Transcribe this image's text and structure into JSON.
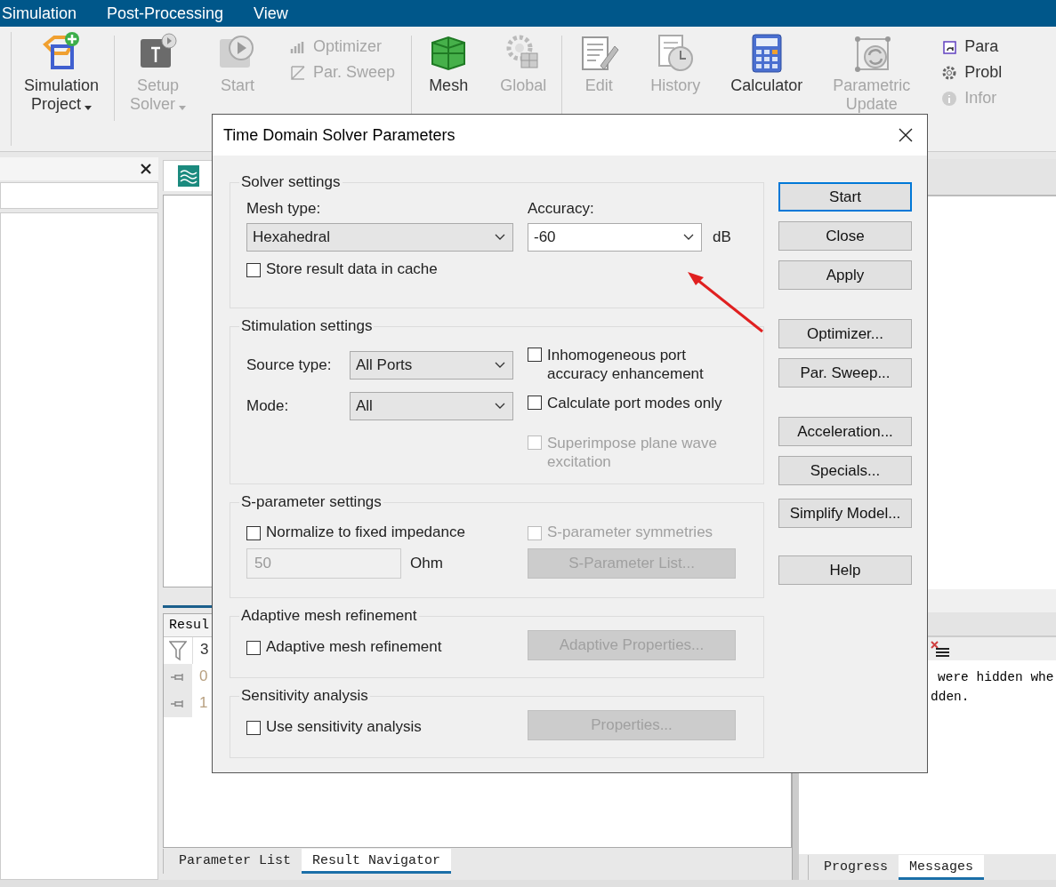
{
  "menu_bar": [
    "Simulation",
    "Post-Processing",
    "View"
  ],
  "ribbon": {
    "columns": [
      {
        "kind": "large",
        "lines": [
          "Simulation",
          "Project"
        ],
        "disabled": false,
        "dropdown": true
      },
      {
        "kind": "separator"
      },
      {
        "kind": "large",
        "lines": [
          "Setup",
          "Solver"
        ],
        "disabled": true,
        "dropdown": true
      },
      {
        "kind": "large",
        "lines": [
          "Start"
        ],
        "disabled": true,
        "dropdown": false
      },
      {
        "kind": "stack",
        "items": [
          {
            "label": "Optimizer",
            "disabled": true
          },
          {
            "label": "Par. Sweep",
            "disabled": true
          }
        ]
      },
      {
        "kind": "separator"
      },
      {
        "kind": "large",
        "lines": [
          "Mesh"
        ],
        "disabled": false,
        "dropdown": false
      },
      {
        "kind": "large",
        "lines": [
          "Global"
        ],
        "disabled": true,
        "dropdown": false
      },
      {
        "kind": "separator"
      },
      {
        "kind": "large",
        "lines": [
          "Edit"
        ],
        "disabled": true,
        "dropdown": false
      },
      {
        "kind": "large",
        "lines": [
          "History"
        ],
        "disabled": true,
        "dropdown": false
      },
      {
        "kind": "large",
        "lines": [
          "Calculator"
        ],
        "disabled": false,
        "dropdown": false
      },
      {
        "kind": "large",
        "lines": [
          "Parametric",
          "Update"
        ],
        "disabled": true,
        "dropdown": false
      },
      {
        "kind": "stack",
        "items": [
          {
            "label": "Para",
            "disabled": false
          },
          {
            "label": "Probl",
            "disabled": false
          },
          {
            "label": "Infor",
            "disabled": true
          }
        ]
      }
    ]
  },
  "result_panel": {
    "title": "Resul",
    "rows": [
      {
        "label": "3",
        "kind": "header"
      },
      {
        "label": "0",
        "kind": "row"
      },
      {
        "label": "1",
        "kind": "row"
      }
    ]
  },
  "bottom_tabs_left": [
    {
      "label": "Parameter List",
      "selected": false
    },
    {
      "label": "Result Navigator",
      "selected": true
    }
  ],
  "messages": [
    "were hidden whe",
    "dden."
  ],
  "bottom_tabs_right": [
    {
      "label": "Progress",
      "selected": false
    },
    {
      "label": "Messages",
      "selected": true
    }
  ],
  "dialog": {
    "title": "Time Domain Solver Parameters",
    "solver_settings": {
      "title": "Solver settings",
      "mesh_type": {
        "label": "Mesh type:",
        "value": "Hexahedral"
      },
      "accuracy": {
        "label": "Accuracy:",
        "value": "-60",
        "unit": "dB"
      },
      "store_cache": {
        "label": "Store result data in cache",
        "checked": false
      }
    },
    "stimulation_settings": {
      "title": "Stimulation settings",
      "source_type": {
        "label": "Source type:",
        "value": "All Ports"
      },
      "mode": {
        "label": "Mode:",
        "value": "All"
      },
      "checkboxes": [
        {
          "label": "Inhomogeneous port accuracy enhancement",
          "checked": false,
          "disabled": false
        },
        {
          "label": "Calculate port modes only",
          "checked": false,
          "disabled": false
        },
        {
          "label": "Superimpose plane wave excitation",
          "checked": false,
          "disabled": true
        }
      ]
    },
    "s_parameter_settings": {
      "title": "S-parameter settings",
      "normalize": {
        "label": "Normalize to fixed impedance",
        "checked": false,
        "disabled": false
      },
      "symmetries": {
        "label": "S-parameter symmetries",
        "checked": false,
        "disabled": true
      },
      "impedance": {
        "value": "50",
        "unit": "Ohm"
      },
      "list_button": {
        "label": "S-Parameter List...",
        "disabled": true
      }
    },
    "adaptive_mesh": {
      "title": "Adaptive mesh refinement",
      "checkbox": {
        "label": "Adaptive mesh refinement",
        "checked": false,
        "disabled": false
      },
      "button": {
        "label": "Adaptive Properties...",
        "disabled": true
      }
    },
    "sensitivity": {
      "title": "Sensitivity analysis",
      "checkbox": {
        "label": "Use sensitivity analysis",
        "checked": false,
        "disabled": false
      },
      "button": {
        "label": "Properties...",
        "disabled": true
      }
    },
    "buttons": [
      {
        "label": "Start",
        "default": true
      },
      {
        "label": "Close",
        "default": false
      },
      {
        "label": "Apply",
        "default": false
      },
      {
        "label": "Optimizer...",
        "default": false
      },
      {
        "label": "Par. Sweep...",
        "default": false
      },
      {
        "label": "Acceleration...",
        "default": false
      },
      {
        "label": "Specials...",
        "default": false
      },
      {
        "label": "Simplify Model...",
        "default": false
      },
      {
        "label": "Help",
        "default": false
      }
    ]
  }
}
